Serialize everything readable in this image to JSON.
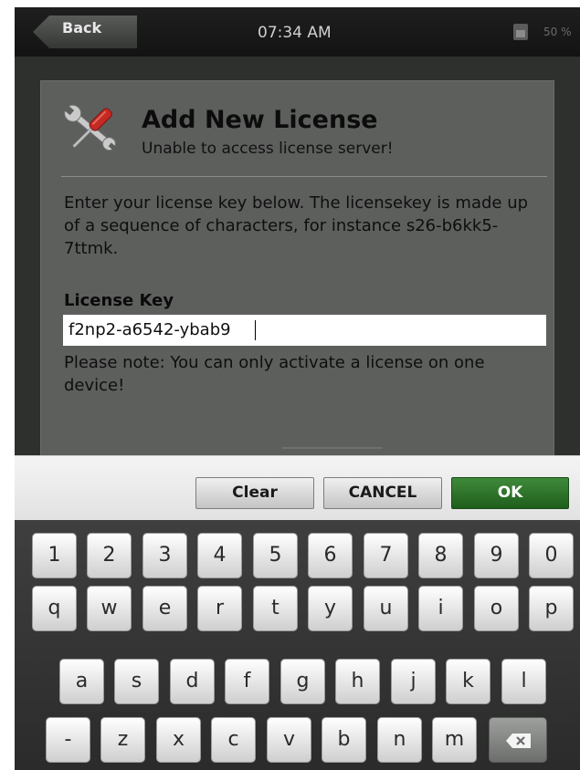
{
  "status_bar": {
    "back_label": "Back",
    "time": "07:34 AM",
    "battery_text": "50 %"
  },
  "dialog": {
    "title": "Add New License",
    "subtitle": "Unable to access license server!",
    "instructions": "Enter your license key below. The licensekey is made up of a sequence of characters, for instance s26-b6kk5-7ttmk.",
    "field_label": "License Key",
    "license_value": "f2np2-a6542-ybab9",
    "note": "Please note: You can only activate a license on one device!",
    "icon": "wrench-screwdriver-icon"
  },
  "actions": {
    "clear_label": "Clear",
    "cancel_label": "CANCEL",
    "ok_label": "OK"
  },
  "keyboard": {
    "row1": [
      "1",
      "2",
      "3",
      "4",
      "5",
      "6",
      "7",
      "8",
      "9",
      "0"
    ],
    "row2": [
      "q",
      "w",
      "e",
      "r",
      "t",
      "y",
      "u",
      "i",
      "o",
      "p"
    ],
    "row3": [
      "a",
      "s",
      "d",
      "f",
      "g",
      "h",
      "j",
      "k",
      "l"
    ],
    "row4": [
      "-",
      "z",
      "x",
      "c",
      "v",
      "b",
      "n",
      "m"
    ],
    "delete_icon": "backspace-icon"
  },
  "colors": {
    "ok_green": "#2f7a2b",
    "dialog_bg": "#5d5f5d",
    "status_bg": "#1a1b1a"
  }
}
